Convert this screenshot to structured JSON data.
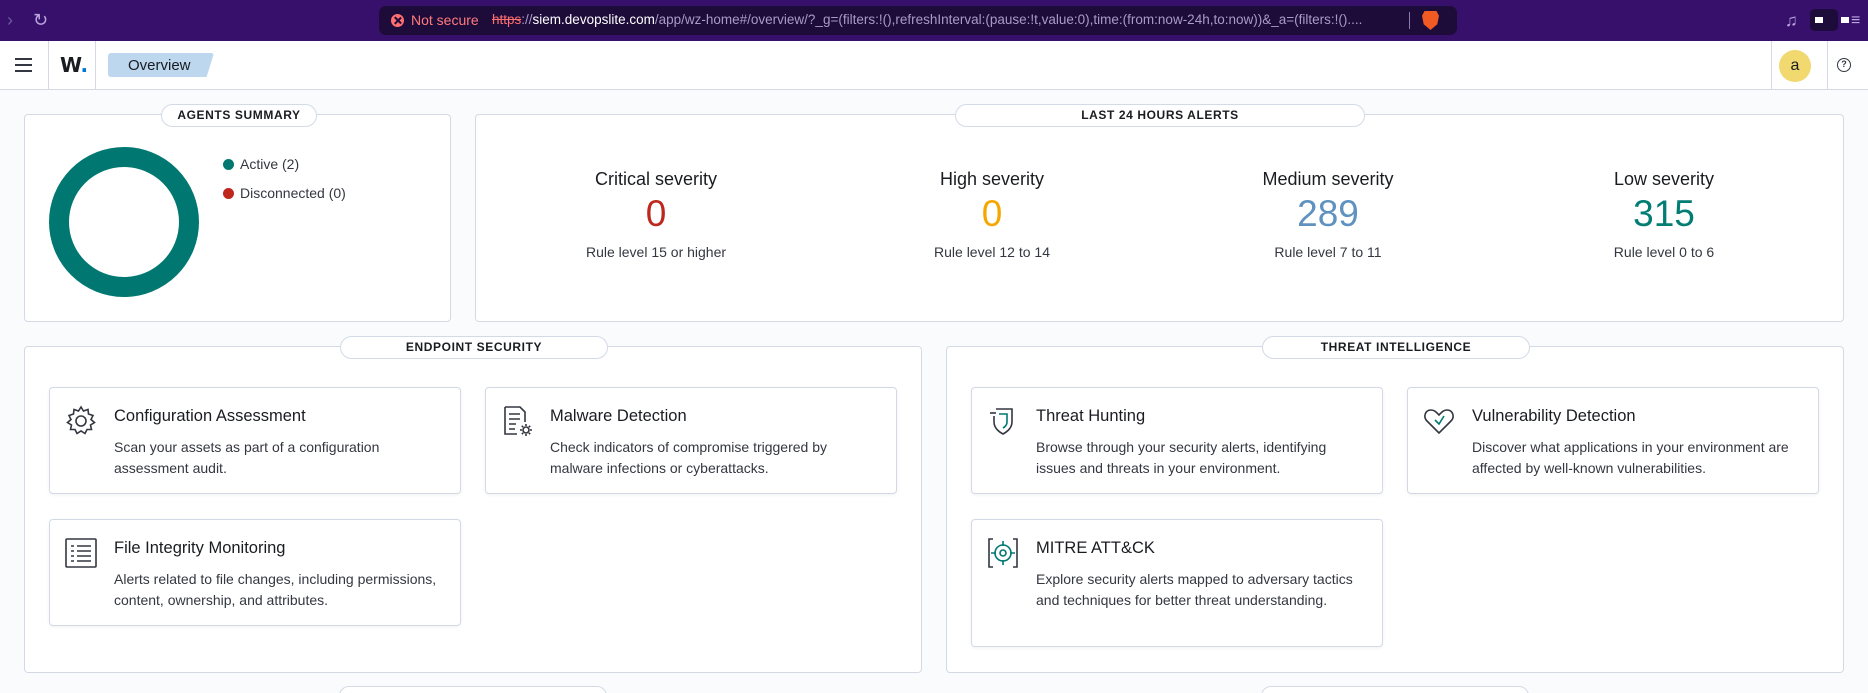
{
  "browser": {
    "not_secure": "Not secure",
    "url_scheme": "https",
    "url_sep": "://",
    "url_host": "siem.devopslite.com",
    "url_path": "/app/wz-home#/overview/?_g=(filters:!(),refreshInterval:(pause:!t,value:0),time:(from:now-24h,to:now))&_a=(filters:!()...."
  },
  "header": {
    "logo_letter": "W",
    "logo_dot": ".",
    "breadcrumb": "Overview",
    "avatar_initial": "a",
    "help_glyph": "?"
  },
  "agents_summary": {
    "title": "AGENTS SUMMARY",
    "legend": [
      {
        "label": "Active (2)",
        "color": "#007871"
      },
      {
        "label": "Disconnected (0)",
        "color": "#bd271e"
      }
    ]
  },
  "alerts": {
    "title": "LAST 24 HOURS ALERTS",
    "severities": [
      {
        "title": "Critical severity",
        "value": "0",
        "desc": "Rule level 15 or higher",
        "color": "#bd271e"
      },
      {
        "title": "High severity",
        "value": "0",
        "desc": "Rule level 12 to 14",
        "color": "#f5a700"
      },
      {
        "title": "Medium severity",
        "value": "289",
        "desc": "Rule level 7 to 11",
        "color": "#6092c0"
      },
      {
        "title": "Low severity",
        "value": "315",
        "desc": "Rule level 0 to 6",
        "color": "#017d73"
      }
    ]
  },
  "endpoint_security": {
    "title": "ENDPOINT SECURITY",
    "cards": [
      {
        "icon": "gear-icon",
        "title": "Configuration Assessment",
        "desc": "Scan your assets as part of a configuration assessment audit."
      },
      {
        "icon": "malware-document-icon",
        "title": "Malware Detection",
        "desc": "Check indicators of compromise triggered by malware infections or cyberattacks."
      },
      {
        "icon": "list-icon",
        "title": "File Integrity Monitoring",
        "desc": "Alerts related to file changes, including permissions, content, ownership, and attributes."
      }
    ]
  },
  "threat_intelligence": {
    "title": "THREAT INTELLIGENCE",
    "cards": [
      {
        "icon": "shield-icon",
        "title": "Threat Hunting",
        "desc": "Browse through your security alerts, identifying issues and threats in your environment."
      },
      {
        "icon": "heart-icon",
        "title": "Vulnerability Detection",
        "desc": "Discover what applications in your environment are affected by well-known vulnerabilities."
      },
      {
        "icon": "crosshair-icon",
        "title": "MITRE ATT&CK",
        "desc": "Explore security alerts mapped to adversary tactics and techniques for better threat understanding."
      }
    ]
  }
}
